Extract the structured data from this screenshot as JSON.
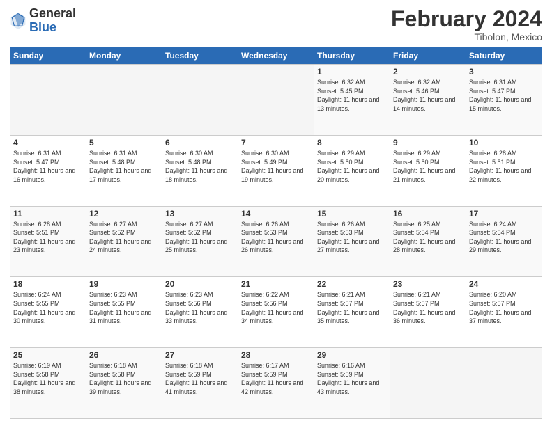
{
  "header": {
    "logo_general": "General",
    "logo_blue": "Blue",
    "month_title": "February 2024",
    "subtitle": "Tibolon, Mexico"
  },
  "days_of_week": [
    "Sunday",
    "Monday",
    "Tuesday",
    "Wednesday",
    "Thursday",
    "Friday",
    "Saturday"
  ],
  "weeks": [
    [
      {
        "day": "",
        "info": ""
      },
      {
        "day": "",
        "info": ""
      },
      {
        "day": "",
        "info": ""
      },
      {
        "day": "",
        "info": ""
      },
      {
        "day": "1",
        "info": "Sunrise: 6:32 AM\nSunset: 5:45 PM\nDaylight: 11 hours and 13 minutes."
      },
      {
        "day": "2",
        "info": "Sunrise: 6:32 AM\nSunset: 5:46 PM\nDaylight: 11 hours and 14 minutes."
      },
      {
        "day": "3",
        "info": "Sunrise: 6:31 AM\nSunset: 5:47 PM\nDaylight: 11 hours and 15 minutes."
      }
    ],
    [
      {
        "day": "4",
        "info": "Sunrise: 6:31 AM\nSunset: 5:47 PM\nDaylight: 11 hours and 16 minutes."
      },
      {
        "day": "5",
        "info": "Sunrise: 6:31 AM\nSunset: 5:48 PM\nDaylight: 11 hours and 17 minutes."
      },
      {
        "day": "6",
        "info": "Sunrise: 6:30 AM\nSunset: 5:48 PM\nDaylight: 11 hours and 18 minutes."
      },
      {
        "day": "7",
        "info": "Sunrise: 6:30 AM\nSunset: 5:49 PM\nDaylight: 11 hours and 19 minutes."
      },
      {
        "day": "8",
        "info": "Sunrise: 6:29 AM\nSunset: 5:50 PM\nDaylight: 11 hours and 20 minutes."
      },
      {
        "day": "9",
        "info": "Sunrise: 6:29 AM\nSunset: 5:50 PM\nDaylight: 11 hours and 21 minutes."
      },
      {
        "day": "10",
        "info": "Sunrise: 6:28 AM\nSunset: 5:51 PM\nDaylight: 11 hours and 22 minutes."
      }
    ],
    [
      {
        "day": "11",
        "info": "Sunrise: 6:28 AM\nSunset: 5:51 PM\nDaylight: 11 hours and 23 minutes."
      },
      {
        "day": "12",
        "info": "Sunrise: 6:27 AM\nSunset: 5:52 PM\nDaylight: 11 hours and 24 minutes."
      },
      {
        "day": "13",
        "info": "Sunrise: 6:27 AM\nSunset: 5:52 PM\nDaylight: 11 hours and 25 minutes."
      },
      {
        "day": "14",
        "info": "Sunrise: 6:26 AM\nSunset: 5:53 PM\nDaylight: 11 hours and 26 minutes."
      },
      {
        "day": "15",
        "info": "Sunrise: 6:26 AM\nSunset: 5:53 PM\nDaylight: 11 hours and 27 minutes."
      },
      {
        "day": "16",
        "info": "Sunrise: 6:25 AM\nSunset: 5:54 PM\nDaylight: 11 hours and 28 minutes."
      },
      {
        "day": "17",
        "info": "Sunrise: 6:24 AM\nSunset: 5:54 PM\nDaylight: 11 hours and 29 minutes."
      }
    ],
    [
      {
        "day": "18",
        "info": "Sunrise: 6:24 AM\nSunset: 5:55 PM\nDaylight: 11 hours and 30 minutes."
      },
      {
        "day": "19",
        "info": "Sunrise: 6:23 AM\nSunset: 5:55 PM\nDaylight: 11 hours and 31 minutes."
      },
      {
        "day": "20",
        "info": "Sunrise: 6:23 AM\nSunset: 5:56 PM\nDaylight: 11 hours and 33 minutes."
      },
      {
        "day": "21",
        "info": "Sunrise: 6:22 AM\nSunset: 5:56 PM\nDaylight: 11 hours and 34 minutes."
      },
      {
        "day": "22",
        "info": "Sunrise: 6:21 AM\nSunset: 5:57 PM\nDaylight: 11 hours and 35 minutes."
      },
      {
        "day": "23",
        "info": "Sunrise: 6:21 AM\nSunset: 5:57 PM\nDaylight: 11 hours and 36 minutes."
      },
      {
        "day": "24",
        "info": "Sunrise: 6:20 AM\nSunset: 5:57 PM\nDaylight: 11 hours and 37 minutes."
      }
    ],
    [
      {
        "day": "25",
        "info": "Sunrise: 6:19 AM\nSunset: 5:58 PM\nDaylight: 11 hours and 38 minutes."
      },
      {
        "day": "26",
        "info": "Sunrise: 6:18 AM\nSunset: 5:58 PM\nDaylight: 11 hours and 39 minutes."
      },
      {
        "day": "27",
        "info": "Sunrise: 6:18 AM\nSunset: 5:59 PM\nDaylight: 11 hours and 41 minutes."
      },
      {
        "day": "28",
        "info": "Sunrise: 6:17 AM\nSunset: 5:59 PM\nDaylight: 11 hours and 42 minutes."
      },
      {
        "day": "29",
        "info": "Sunrise: 6:16 AM\nSunset: 5:59 PM\nDaylight: 11 hours and 43 minutes."
      },
      {
        "day": "",
        "info": ""
      },
      {
        "day": "",
        "info": ""
      }
    ]
  ]
}
